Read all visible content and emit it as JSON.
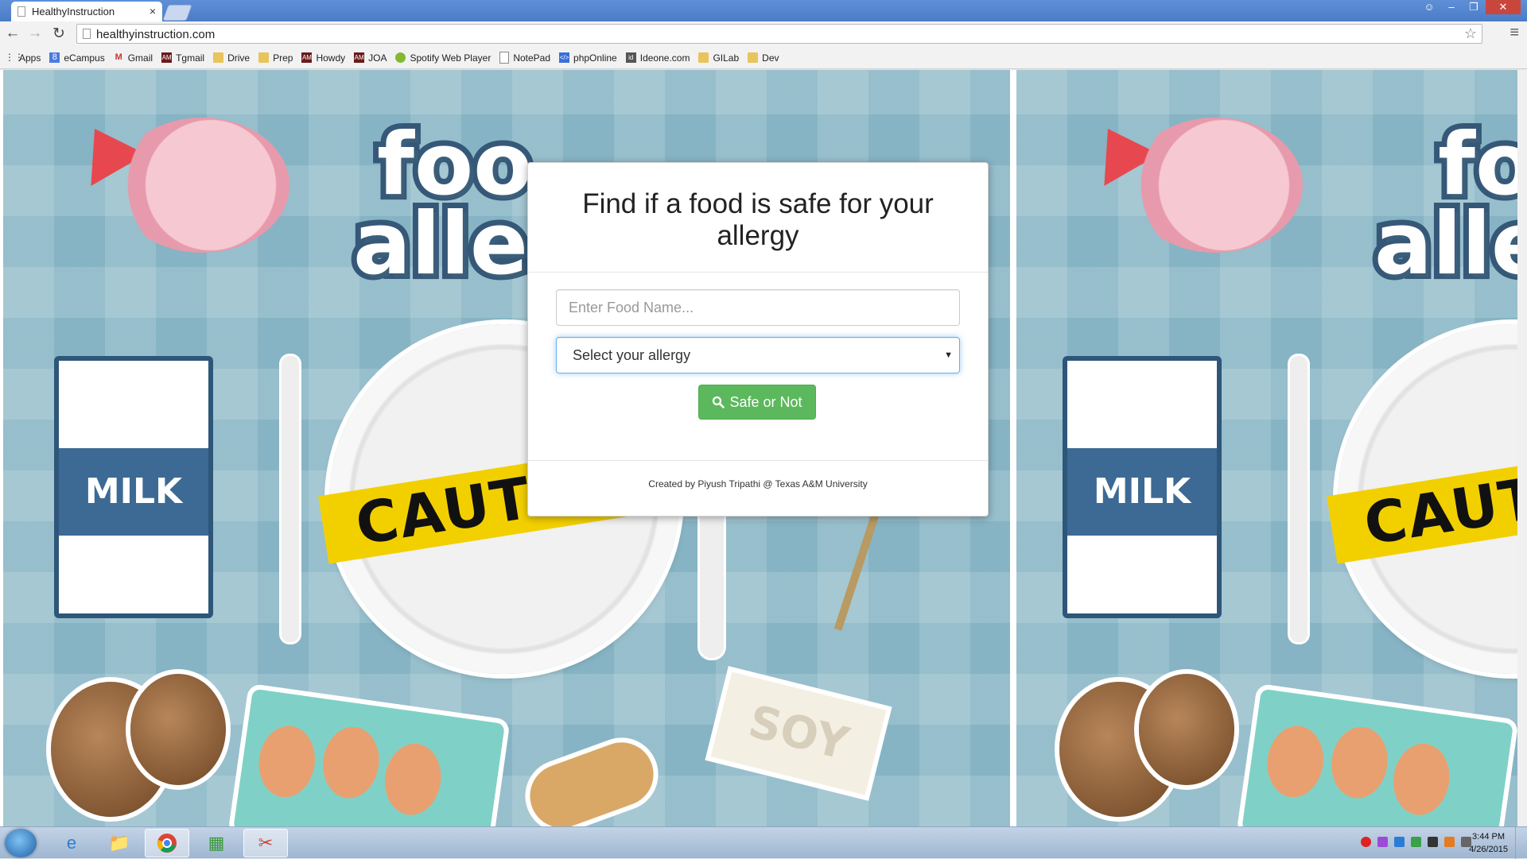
{
  "browser": {
    "tab_title": "HealthyInstruction",
    "tab_close": "×",
    "url": "healthyinstruction.com",
    "bookmarks": [
      {
        "label": "Apps",
        "icon": "apps-grid-icon"
      },
      {
        "label": "eCampus",
        "icon": "google-icon"
      },
      {
        "label": "Gmail",
        "icon": "gmail-icon"
      },
      {
        "label": "Tgmail",
        "icon": "tamu-icon"
      },
      {
        "label": "Drive",
        "icon": "folder-icon"
      },
      {
        "label": "Prep",
        "icon": "folder-icon"
      },
      {
        "label": "Howdy",
        "icon": "tamu-icon"
      },
      {
        "label": "JOA",
        "icon": "tamu-icon"
      },
      {
        "label": "Spotify Web Player",
        "icon": "spotify-icon"
      },
      {
        "label": "NotePad",
        "icon": "page-icon"
      },
      {
        "label": "phpOnline",
        "icon": "php-icon"
      },
      {
        "label": "Ideone.com",
        "icon": "ideone-icon"
      },
      {
        "label": "GILab",
        "icon": "folder-icon"
      },
      {
        "label": "Dev",
        "icon": "folder-icon"
      }
    ]
  },
  "illustration": {
    "logo_line1": "foo",
    "logo_line2": "allerg",
    "milk_label": "MILK",
    "caution_label": "CAUTION",
    "soy_label": "SOY"
  },
  "form": {
    "title": "Find if a food is safe for your allergy",
    "food_placeholder": "Enter Food Name...",
    "food_value": "",
    "allergy_selected": "Select your allergy",
    "submit_label": "Safe or Not",
    "footer": "Created by Piyush Tripathi @ Texas A&M University"
  },
  "taskbar": {
    "apps": [
      "windows-start",
      "internet-explorer",
      "file-explorer",
      "chrome",
      "spreadsheet-app",
      "snipping-tool"
    ],
    "time": "3:44 PM",
    "date": "4/26/2015"
  },
  "colors": {
    "button_green": "#5cb85c",
    "background_teal": "#86b4c4",
    "caution_yellow": "#f2d000",
    "titlebar_blue": "#4a7cc7"
  }
}
